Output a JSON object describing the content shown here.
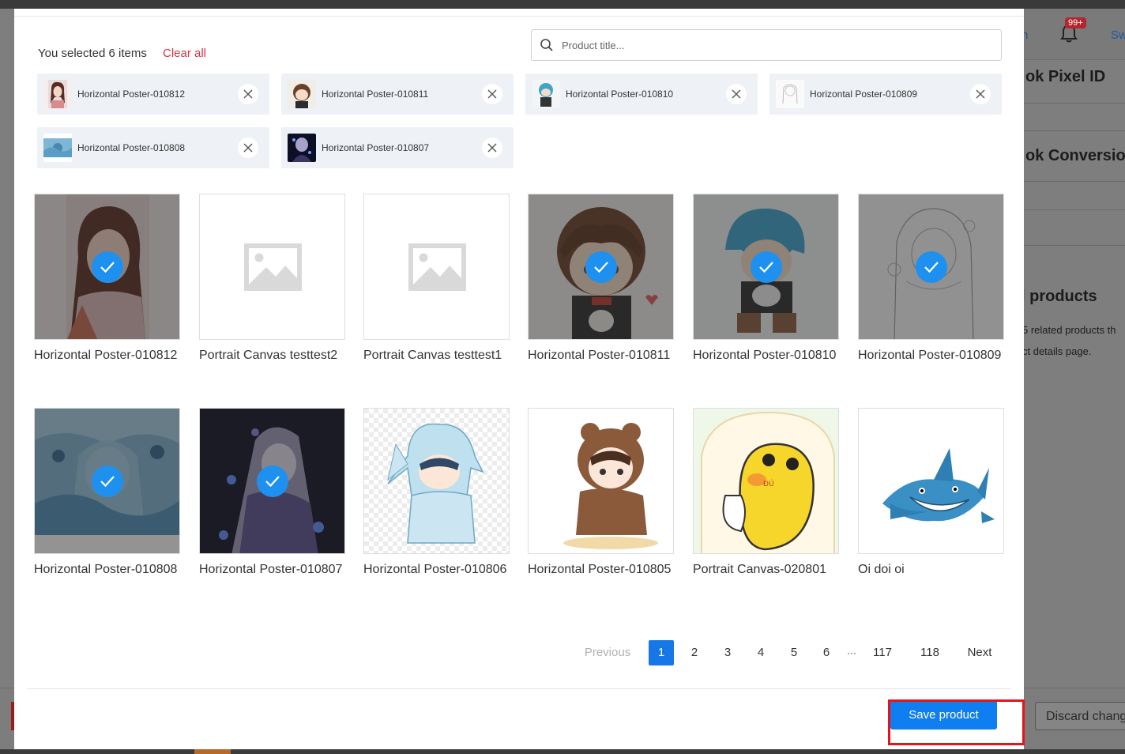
{
  "background": {
    "notification_badge": "99+",
    "header_link_partial": "Sw",
    "header_text_partial": "n",
    "sections": [
      {
        "text": "ok Pixel ID"
      },
      {
        "text": "ok Conversion"
      },
      {
        "text": "l products"
      }
    ],
    "desc_line1": "5 related products th",
    "desc_line2": "ct details page.",
    "discard_label": "Discard chang"
  },
  "modal": {
    "selected_text": "You selected 6 items",
    "clear_all": "Clear all",
    "search_placeholder": "Product title...",
    "chips": [
      {
        "label": "Horizontal Poster-010812"
      },
      {
        "label": "Horizontal Poster-010811"
      },
      {
        "label": "Horizontal Poster-010810"
      },
      {
        "label": "Horizontal Poster-010809"
      },
      {
        "label": "Horizontal Poster-010808"
      },
      {
        "label": "Horizontal Poster-010807"
      }
    ],
    "products": [
      {
        "title": "Horizontal Poster-010812",
        "selected": true
      },
      {
        "title": "Portrait Canvas testtest2",
        "selected": false
      },
      {
        "title": "Portrait Canvas testtest1",
        "selected": false
      },
      {
        "title": "Horizontal Poster-010811",
        "selected": true
      },
      {
        "title": "Horizontal Poster-010810",
        "selected": true
      },
      {
        "title": "Horizontal Poster-010809",
        "selected": true
      },
      {
        "title": "Horizontal Poster-010808",
        "selected": true
      },
      {
        "title": "Horizontal Poster-010807",
        "selected": true
      },
      {
        "title": "Horizontal Poster-010806",
        "selected": false
      },
      {
        "title": "Horizontal Poster-010805",
        "selected": false
      },
      {
        "title": "Portrait Canvas-020801",
        "selected": false
      },
      {
        "title": "Oi doi oi",
        "selected": false
      }
    ],
    "pagination": {
      "previous": "Previous",
      "pages": [
        "1",
        "2",
        "3",
        "4",
        "5",
        "6"
      ],
      "ellipsis": "···",
      "last_pages": [
        "117",
        "118"
      ],
      "next": "Next",
      "current": "1"
    },
    "save_label": "Save product"
  },
  "colors": {
    "primary": "#1677e6",
    "check": "#1e90f0",
    "clear_all": "#e02f44",
    "highlight": "#e8121c"
  }
}
